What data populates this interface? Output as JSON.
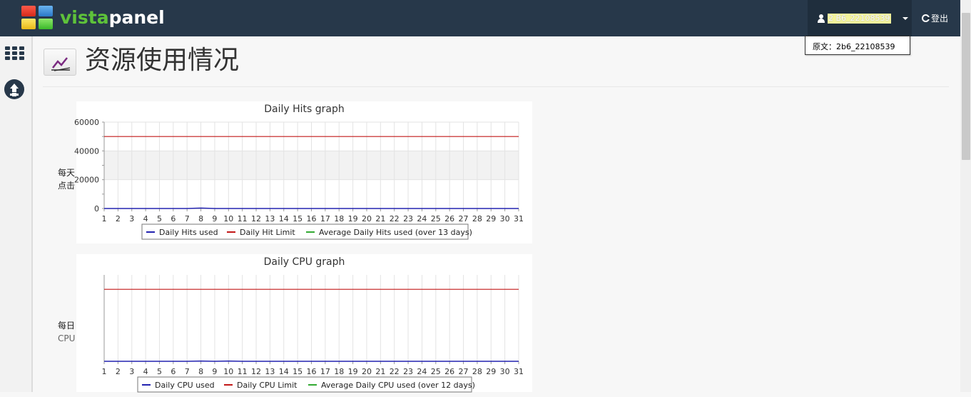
{
  "brand": {
    "part1": "vista",
    "part2": "panel"
  },
  "user": {
    "name": "2 B6_22108539",
    "tooltip": "原文：2b6_22108539"
  },
  "logout_label": "登出",
  "page_title": "资源使用情况",
  "colors": {
    "topbar": "#27384a",
    "used": "#2323b0",
    "limit": "#c21818",
    "average": "#33aa33"
  },
  "charts": [
    {
      "title": "Daily Hits graph",
      "ylabel_line1": "每天",
      "ylabel_line2": "点击",
      "legend": [
        "Daily Hits used",
        "Daily Hit Limit",
        "Average Daily Hits used (over 13 days)"
      ]
    },
    {
      "title": "Daily CPU graph",
      "ylabel_line1": "每日",
      "ylabel_line2": "CPU",
      "legend": [
        "Daily CPU used",
        "Daily CPU Limit",
        "Average Daily CPU used (over 12 days)"
      ]
    }
  ],
  "chart_data": [
    {
      "type": "line",
      "title": "Daily Hits graph",
      "xlabel": "",
      "ylabel": "每天 点击",
      "x": [
        1,
        2,
        3,
        4,
        5,
        6,
        7,
        8,
        9,
        10,
        11,
        12,
        13,
        14,
        15,
        16,
        17,
        18,
        19,
        20,
        21,
        22,
        23,
        24,
        25,
        26,
        27,
        28,
        29,
        30,
        31
      ],
      "yticks": [
        0,
        20000,
        40000,
        60000
      ],
      "ylim": [
        0,
        60000
      ],
      "grid": true,
      "legend_position": "bottom",
      "series": [
        {
          "name": "Daily Hits used",
          "values": [
            0,
            0,
            0,
            0,
            0,
            0,
            0,
            300,
            0,
            0,
            0,
            0,
            0,
            0,
            0,
            0,
            0,
            0,
            0,
            0,
            0,
            0,
            0,
            0,
            0,
            0,
            0,
            0,
            0,
            0,
            0
          ]
        },
        {
          "name": "Daily Hit Limit",
          "values": [
            50000,
            50000,
            50000,
            50000,
            50000,
            50000,
            50000,
            50000,
            50000,
            50000,
            50000,
            50000,
            50000,
            50000,
            50000,
            50000,
            50000,
            50000,
            50000,
            50000,
            50000,
            50000,
            50000,
            50000,
            50000,
            50000,
            50000,
            50000,
            50000,
            50000,
            50000
          ]
        },
        {
          "name": "Average Daily Hits used (over 13 days)",
          "values": []
        }
      ]
    },
    {
      "type": "line",
      "title": "Daily CPU graph",
      "xlabel": "",
      "ylabel": "每日 CPU",
      "x": [
        1,
        2,
        3,
        4,
        5,
        6,
        7,
        8,
        9,
        10,
        11,
        12,
        13,
        14,
        15,
        16,
        17,
        18,
        19,
        20,
        21,
        22,
        23,
        24,
        25,
        26,
        27,
        28,
        29,
        30,
        31
      ],
      "yticks": [],
      "ylim": [
        0,
        120
      ],
      "grid": true,
      "legend_position": "bottom",
      "series": [
        {
          "name": "Daily CPU used",
          "values": [
            0,
            0,
            0,
            0,
            0,
            0,
            0,
            0.4,
            0,
            0.4,
            0,
            0,
            0,
            0,
            0,
            0,
            0,
            0,
            0,
            0,
            0,
            0,
            0,
            0,
            0,
            0,
            0,
            0,
            0,
            0,
            0
          ]
        },
        {
          "name": "Daily CPU Limit",
          "values": [
            100,
            100,
            100,
            100,
            100,
            100,
            100,
            100,
            100,
            100,
            100,
            100,
            100,
            100,
            100,
            100,
            100,
            100,
            100,
            100,
            100,
            100,
            100,
            100,
            100,
            100,
            100,
            100,
            100,
            100,
            100
          ]
        },
        {
          "name": "Average Daily CPU used (over 12 days)",
          "values": []
        }
      ]
    }
  ]
}
